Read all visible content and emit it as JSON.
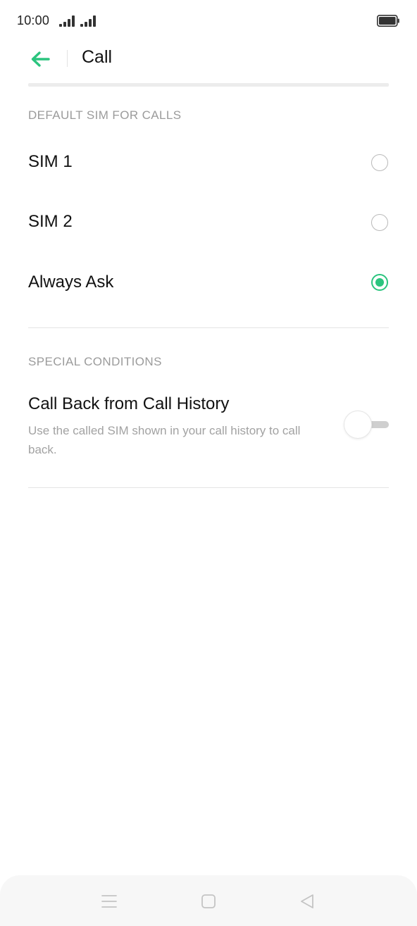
{
  "status_bar": {
    "time": "10:00",
    "icons": [
      "signal-icon",
      "signal-icon",
      "battery-icon"
    ]
  },
  "header": {
    "title": "Call",
    "back_icon": "back-arrow-icon"
  },
  "default_sim": {
    "section_label": "DEFAULT SIM FOR CALLS",
    "options": [
      {
        "label": "SIM 1",
        "selected": false
      },
      {
        "label": "SIM 2",
        "selected": false
      },
      {
        "label": "Always Ask",
        "selected": true
      }
    ]
  },
  "special_conditions": {
    "section_label": "SPECIAL CONDITIONS",
    "call_back": {
      "title": "Call Back from Call History",
      "description": "Use the called SIM shown in your call history to call back.",
      "enabled": false
    }
  },
  "nav_bar": {
    "icons": [
      "menu-icon",
      "home-icon",
      "back-icon"
    ]
  },
  "colors": {
    "accent": "#2bc47e",
    "secondary_text": "#9b9b9b",
    "divider": "#e4e4e4"
  }
}
